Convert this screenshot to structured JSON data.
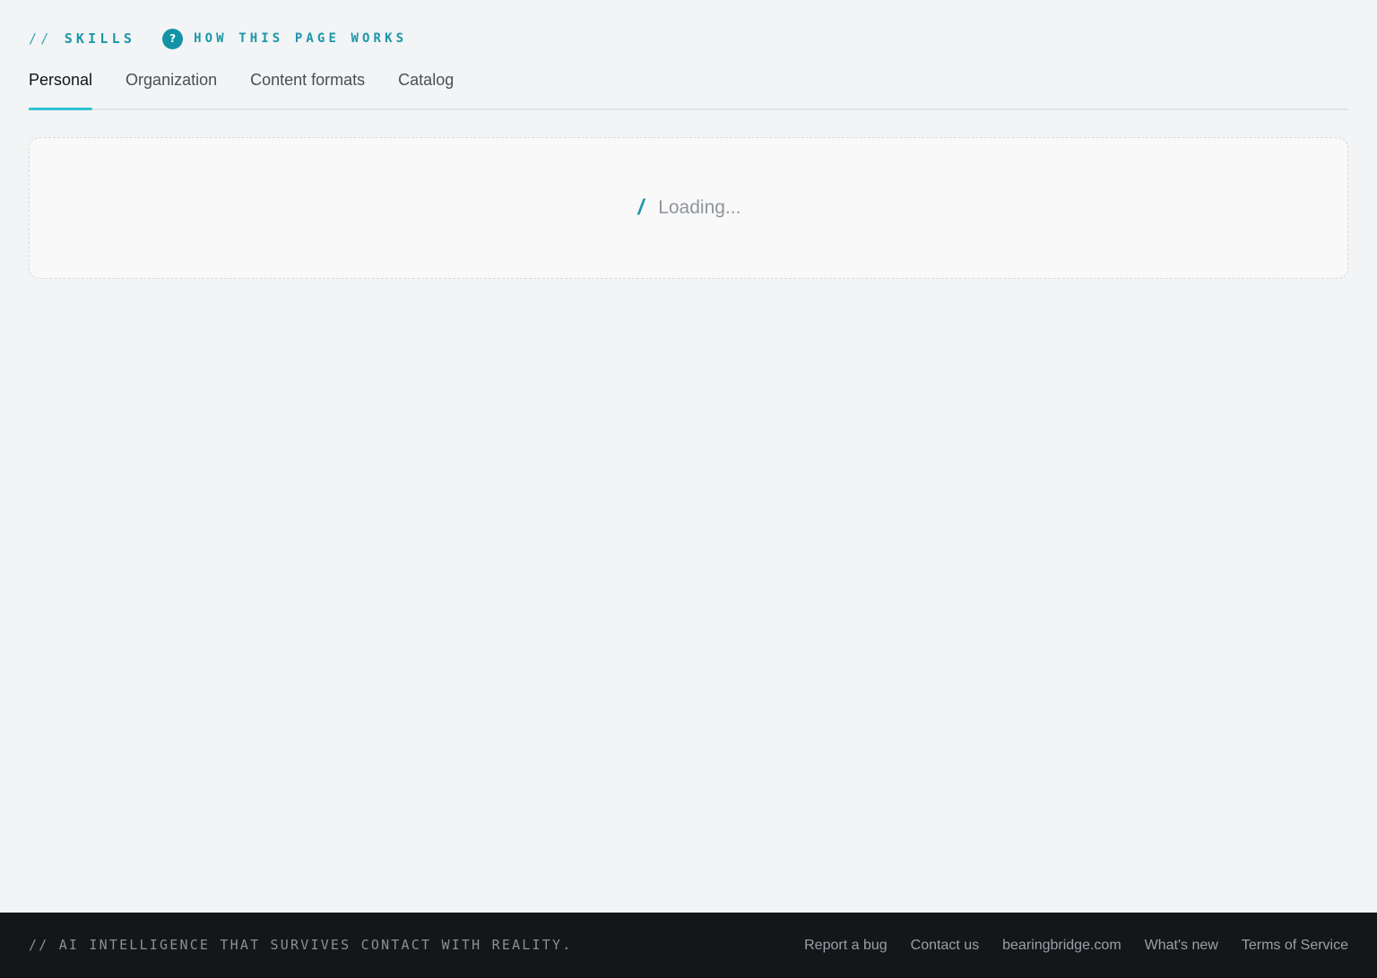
{
  "header": {
    "section_slashes": "//",
    "section_title": "SKILLS",
    "help_icon_glyph": "?",
    "help_label": "HOW THIS PAGE WORKS"
  },
  "tabs": [
    {
      "label": "Personal",
      "active": true
    },
    {
      "label": "Organization",
      "active": false
    },
    {
      "label": "Content formats",
      "active": false
    },
    {
      "label": "Catalog",
      "active": false
    }
  ],
  "loading": {
    "spinner_glyph": "/",
    "text": "Loading..."
  },
  "footer": {
    "tagline": "// AI INTELLIGENCE THAT SURVIVES CONTACT WITH REALITY.",
    "links": [
      {
        "label": "Report a bug"
      },
      {
        "label": "Contact us"
      },
      {
        "label": "bearingbridge.com"
      },
      {
        "label": "What's new"
      },
      {
        "label": "Terms of Service"
      }
    ]
  },
  "colors": {
    "accent": "#1c96a9",
    "tab_underline": "#30c3d4",
    "page_background": "#f2f4f5",
    "footer_background": "#141619"
  },
  "icons": {
    "help": "question-circle-icon",
    "spinner": "slash-spinner-icon"
  }
}
